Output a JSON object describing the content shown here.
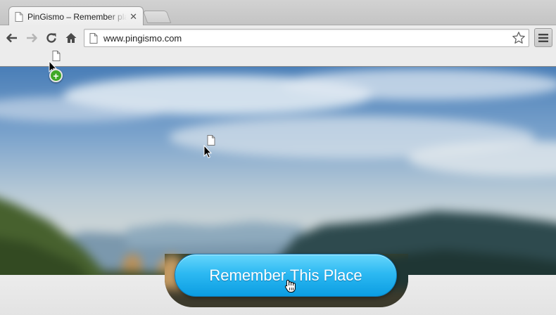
{
  "browser": {
    "tab": {
      "title": "PinGismo – Remember place",
      "close_glyph": "✕"
    },
    "address_bar": {
      "url": "www.pingismo.com"
    },
    "icons": [
      "back-arrow-icon",
      "forward-arrow-icon",
      "reload-icon",
      "home-icon",
      "page-icon",
      "star-icon",
      "menu-icon"
    ]
  },
  "page": {
    "hero_image": "blurred mountain landscape",
    "cta_button": {
      "label": "Remember This Place"
    }
  },
  "overlays": {
    "drag_add_badge": "+",
    "cursor_types": [
      "arrow-cursor",
      "hand-cursor"
    ]
  },
  "colors": {
    "cta_top": "#66d6fb",
    "cta_bottom": "#0b9de2",
    "add_badge": "#3fa827"
  }
}
